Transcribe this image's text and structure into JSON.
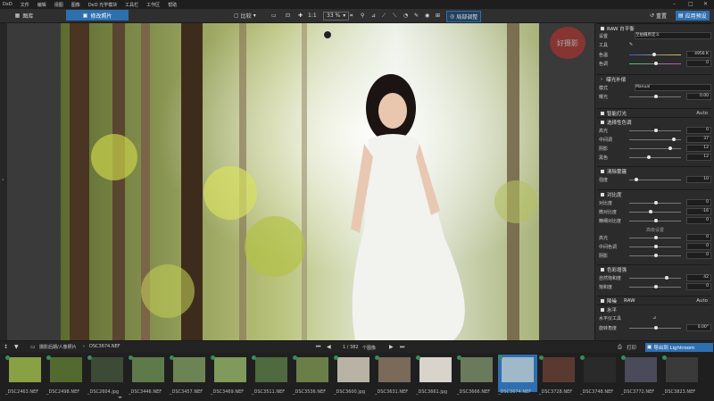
{
  "menu": {
    "logo": "DxO",
    "items": [
      "文件",
      "编辑",
      "视图",
      "图像",
      "DxO 光学模块",
      "工具栏",
      "工作区",
      "帮助"
    ],
    "window_controls": [
      "–",
      "□",
      "✕"
    ]
  },
  "tabs": {
    "library": "图库",
    "customize": "修改照片"
  },
  "toolbar": {
    "compare": "比较",
    "ratio": "1:1",
    "zoom": "33 %",
    "local_adjust": "局部调整",
    "reset": "重置",
    "apply_preset": "应用预设"
  },
  "panel": {
    "raw_wb_title": "RAW 白平衡",
    "wb_preset_label": "设置",
    "wb_preset_value": "至拍摄原定义",
    "tool_label": "工具",
    "temp_label": "色温",
    "temp_value": "4956 K",
    "tint_label": "色调",
    "tint_value": "0",
    "exposure_title": "曝光补偿",
    "mode_label": "模式",
    "mode_value": "Manual",
    "exp_label": "曝光",
    "exp_value": "0.00",
    "smart_lighting": "智能灯光",
    "smart_lighting_val": "Auto",
    "selective_tone": "选择性色调",
    "highlights_label": "高光",
    "highlights_value": "0",
    "midtones_label": "中间调",
    "midtones_value": "37",
    "shadows_label": "阴影",
    "shadows_value": "12",
    "blacks_label": "黑色",
    "blacks_value": "12",
    "clearview": "清除雾霾",
    "clearview_label": "强度",
    "clearview_value": "10",
    "contrast_title": "对比度",
    "contrast_label": "对比度",
    "contrast_value": "0",
    "microcontrast_label": "微对比度",
    "microcontrast_value": "-16",
    "fine_contrast_label": "精细对比度",
    "fine_contrast_value": "0",
    "band_label": "高级设置",
    "hl_label": "高光",
    "hl_value": "0",
    "mt_label": "中间色调",
    "mt_value": "0",
    "sh_label": "阴影",
    "sh_value": "0",
    "color_title": "色彩增强",
    "vibrancy_label": "自然饱和度",
    "vibrancy_value": "42",
    "saturation_label": "饱和度",
    "saturation_value": "0",
    "denoise_title": "降噪",
    "denoise_val_a": "RAW",
    "denoise_val_b": "Auto",
    "horizon_title": "水平",
    "horizon_sub": "水平仪工具",
    "rotate_label": "旋转角度",
    "rotate_value": "0.00°"
  },
  "status": {
    "folder": "摄影后期/人像照片",
    "file": "DSC3674.NEF",
    "counter": "1 / 382",
    "count_label": "个图像",
    "print": "打印",
    "export": "导出到 Lightroom"
  },
  "watermark": "好摄影",
  "thumbs": [
    "_DSC2463.NEF",
    "_DSC2498.NEF",
    "_DSC2604.jpg",
    "_DSC3446.NEF",
    "_DSC3457.NEF",
    "_DSC3469.NEF",
    "_DSC3511.NEF",
    "_DSC3536.NEF",
    "_DSC3600.jpg",
    "_DSC3631.NEF",
    "_DSC3661.jpg",
    "_DSC3666.NEF",
    "_DSC3674.NEF",
    "_DSC3728.NEF",
    "_DSC3748.NEF",
    "_DSC3772.NEF",
    "_DSC3823.NEF"
  ],
  "colors": {
    "accent": "#2e6fb0",
    "panel": "#2b2b2b",
    "bar": "#1e1e1e"
  }
}
